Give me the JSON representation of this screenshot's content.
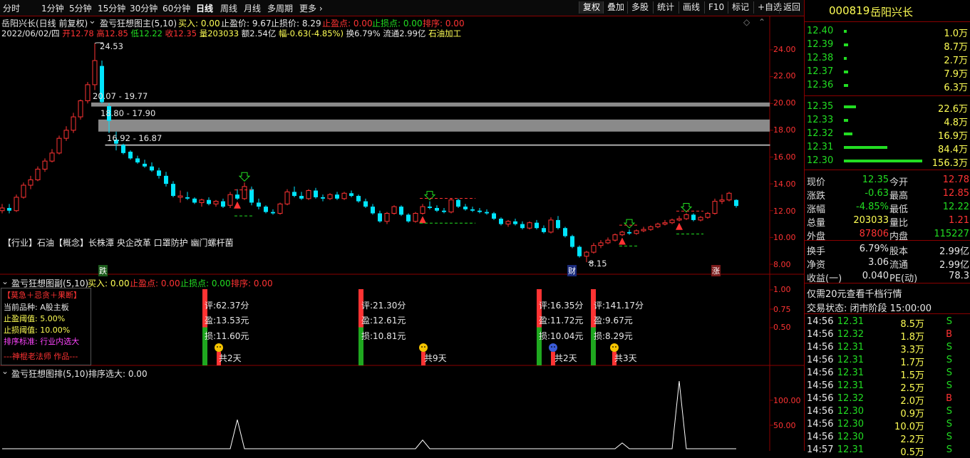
{
  "topbar": {
    "periods": [
      "分时",
      "1分钟",
      "5分钟",
      "15分钟",
      "30分钟",
      "60分钟",
      "日线",
      "周线",
      "月线",
      "多周期",
      "更多"
    ],
    "active_period": "日线",
    "right_buttons": [
      "复权",
      "叠加",
      "多股",
      "统计",
      "画线",
      "F10",
      "标记",
      "+自选",
      "返回"
    ],
    "active_right": "复权"
  },
  "chart_header": {
    "stock_title": "岳阳兴长(日线 前复权)",
    "indicator_main": "盈亏狂想图主(5,10)",
    "buy_label": "买入: 0.00",
    "profit_price_label": "止盈价: 9.67",
    "stop_price_label": "止损价: 8.29",
    "stop_profit_point": "止盈点: 0.00",
    "stop_loss_point": "止损点: 0.00",
    "rank": "排序: 0.00"
  },
  "quote_line": {
    "date": "2022/06/02/四",
    "open": "开12.78",
    "high": "高12.85",
    "low": "低12.22",
    "close": "收12.35",
    "volume": "量203033",
    "amount": "额2.54亿",
    "change": "幅-0.63(-4.85%)",
    "turnover": "换6.79%",
    "float_cap": "流通2.99亿",
    "industry": "石油加工"
  },
  "annotations": {
    "high_price": "24.53",
    "gap1": "20.07 - 19.77",
    "gap2": "18.80 - 17.90",
    "gap3": "16.92 - 16.87",
    "low_price": "8.15",
    "marker_die": "跌",
    "marker_cai": "财",
    "marker_zhang": "涨",
    "concept_text": "【行业】石油【概念】长株潭 央企改革 口罩防护 幽门螺杆菌"
  },
  "main_axis": [
    "24.00",
    "22.00",
    "20.00",
    "18.00",
    "16.00",
    "14.00",
    "12.00",
    "10.00",
    "8.00"
  ],
  "sub1": {
    "title": "盈亏狂想图副(5,10)",
    "buy": "买入: 0.00",
    "stop_profit": "止盈点: 0.00",
    "stop_loss": "止损点: 0.00",
    "rank": "排序: 0.00",
    "axis": [
      "1.00",
      "0.75",
      "0.50"
    ],
    "info_head": "【莫急＋忌贪＋果断】",
    "info_lines": [
      "当前品种:  A股主板",
      "止盈阈值:  5.00%",
      "止损阈值:  10.00%",
      "排序标准:  行业内选大",
      "---神棍老法师 作品---"
    ],
    "signals": [
      {
        "score": "评:62.37分",
        "profit": "盈:13.53元",
        "loss": "损:11.60元",
        "days": "共2天"
      },
      {
        "score": "评:21.30分",
        "profit": "盈:12.61元",
        "loss": "损:10.81元",
        "days": "共9天"
      },
      {
        "score": "评:16.35分",
        "profit": "盈:11.72元",
        "loss": "损:10.04元",
        "days": "共2天"
      },
      {
        "score": "评:141.17分",
        "profit": "盈:9.67元",
        "loss": "损:8.29元",
        "days": "共3天"
      }
    ]
  },
  "sub2": {
    "title": "盈亏狂想图排(5,10)",
    "rank": "排序选大: 0.00",
    "axis": [
      "100.00",
      "50.00"
    ]
  },
  "right_panel": {
    "code": "000819",
    "name": "岳阳兴长",
    "asks": [
      {
        "price": "12.40",
        "vol": "1.0万",
        "bar": 0.03
      },
      {
        "price": "12.39",
        "vol": "8.7万",
        "bar": 0.05
      },
      {
        "price": "12.38",
        "vol": "2.7万",
        "bar": 0.04
      },
      {
        "price": "12.37",
        "vol": "7.9万",
        "bar": 0.05
      },
      {
        "price": "12.36",
        "vol": "6.3万",
        "bar": 0.05
      }
    ],
    "bids": [
      {
        "price": "12.35",
        "vol": "22.6万",
        "bar": 0.15
      },
      {
        "price": "12.33",
        "vol": "4.8万",
        "bar": 0.05
      },
      {
        "price": "12.32",
        "vol": "16.9万",
        "bar": 0.11
      },
      {
        "price": "12.31",
        "vol": "84.4万",
        "bar": 0.55
      },
      {
        "price": "12.30",
        "vol": "156.3万",
        "bar": 1.0
      }
    ],
    "stats": [
      {
        "l1": "现价",
        "v1": "12.35",
        "c1": "g",
        "l2": "今开",
        "v2": "12.78",
        "c2": "r"
      },
      {
        "l1": "涨跌",
        "v1": "-0.63",
        "c1": "g",
        "l2": "最高",
        "v2": "12.85",
        "c2": "r"
      },
      {
        "l1": "涨幅",
        "v1": "-4.85%",
        "c1": "g",
        "l2": "最低",
        "v2": "12.22",
        "c2": "g"
      },
      {
        "l1": "总量",
        "v1": "203033",
        "c1": "y",
        "l2": "量比",
        "v2": "1.21",
        "c2": "r"
      },
      {
        "l1": "外盘",
        "v1": "87806",
        "c1": "r",
        "l2": "内盘",
        "v2": "115227",
        "c2": "g"
      }
    ],
    "stats2": [
      {
        "l1": "换手",
        "v1": "6.79%",
        "l2": "股本",
        "v2": "2.99亿"
      },
      {
        "l1": "净资",
        "v1": "3.06",
        "l2": "流通",
        "v2": "2.99亿"
      },
      {
        "l1": "收益(一)",
        "v1": "0.040",
        "l2": "PE(动)",
        "v2": "78.3"
      }
    ],
    "promo": "仅需20元查看千档行情",
    "trade_state": "交易状态: 闭市阶段 15:00:00",
    "ticks": [
      {
        "t": "14:56",
        "p": "12.31",
        "v": "8.5万",
        "s": "S"
      },
      {
        "t": "14:56",
        "p": "12.32",
        "v": "1.8万",
        "s": "B"
      },
      {
        "t": "14:56",
        "p": "12.31",
        "v": "3.3万",
        "s": "S"
      },
      {
        "t": "14:56",
        "p": "12.31",
        "v": "1.7万",
        "s": "S"
      },
      {
        "t": "14:56",
        "p": "12.31",
        "v": "1.5万",
        "s": "S"
      },
      {
        "t": "14:56",
        "p": "12.31",
        "v": "2.5万",
        "s": "S"
      },
      {
        "t": "14:56",
        "p": "12.32",
        "v": "2.0万",
        "s": "B"
      },
      {
        "t": "14:56",
        "p": "12.30",
        "v": "0.9万",
        "s": "S"
      },
      {
        "t": "14:56",
        "p": "12.30",
        "v": "10.0万",
        "s": "S"
      },
      {
        "t": "14:56",
        "p": "12.30",
        "v": "2.2万",
        "s": "S"
      },
      {
        "t": "14:57",
        "p": "12.31",
        "v": "0.5万",
        "s": "S"
      }
    ]
  },
  "chart_data": {
    "type": "candlestick",
    "title": "岳阳兴长(日线 前复权)",
    "ylim": [
      7.4,
      25.8
    ],
    "candles": [
      [
        12.0,
        12.5,
        11.8,
        12.2
      ],
      [
        12.2,
        12.5,
        11.8,
        12.0
      ],
      [
        12.0,
        13.2,
        11.9,
        13.0
      ],
      [
        13.0,
        14.1,
        12.9,
        13.9
      ],
      [
        13.9,
        14.6,
        13.6,
        14.3
      ],
      [
        14.3,
        15.3,
        14.2,
        15.1
      ],
      [
        15.1,
        15.9,
        14.9,
        15.7
      ],
      [
        15.7,
        16.6,
        15.6,
        16.3
      ],
      [
        16.3,
        17.6,
        16.2,
        17.4
      ],
      [
        17.4,
        18.3,
        17.2,
        18.0
      ],
      [
        18.0,
        19.3,
        17.8,
        19.0
      ],
      [
        19.0,
        20.3,
        18.8,
        20.2
      ],
      [
        20.2,
        21.6,
        20.0,
        21.4
      ],
      [
        21.4,
        24.5,
        21.0,
        23.2
      ],
      [
        22.8,
        23.2,
        20.0,
        20.1
      ],
      [
        19.8,
        20.0,
        17.8,
        18.7
      ],
      [
        17.3,
        17.9,
        16.5,
        17.0
      ],
      [
        16.9,
        17.0,
        16.2,
        16.3
      ],
      [
        16.4,
        16.5,
        15.8,
        15.9
      ],
      [
        15.9,
        16.1,
        15.5,
        15.6
      ],
      [
        15.5,
        15.8,
        15.2,
        15.3
      ],
      [
        15.3,
        15.6,
        14.9,
        15.0
      ],
      [
        15.0,
        15.2,
        14.4,
        14.6
      ],
      [
        14.6,
        14.9,
        13.8,
        14.0
      ],
      [
        14.0,
        14.2,
        13.0,
        13.1
      ],
      [
        13.0,
        13.5,
        12.6,
        13.1
      ],
      [
        13.0,
        13.4,
        12.8,
        12.9
      ],
      [
        12.9,
        13.0,
        12.5,
        12.6
      ],
      [
        12.6,
        12.9,
        12.3,
        12.8
      ],
      [
        12.8,
        13.0,
        12.4,
        12.5
      ],
      [
        12.5,
        12.8,
        12.3,
        12.7
      ],
      [
        12.7,
        12.9,
        12.2,
        12.3
      ],
      [
        12.4,
        13.4,
        12.2,
        13.2
      ],
      [
        13.2,
        13.6,
        12.8,
        12.9
      ],
      [
        12.9,
        14.1,
        12.8,
        13.8
      ],
      [
        13.6,
        13.8,
        12.4,
        12.6
      ],
      [
        12.6,
        12.9,
        12.1,
        12.3
      ],
      [
        12.3,
        12.4,
        11.8,
        11.9
      ],
      [
        11.9,
        12.1,
        11.7,
        11.8
      ],
      [
        11.8,
        12.6,
        11.7,
        12.5
      ],
      [
        12.5,
        13.6,
        12.4,
        13.4
      ],
      [
        13.4,
        13.8,
        13.0,
        13.1
      ],
      [
        13.1,
        13.4,
        12.8,
        12.9
      ],
      [
        12.9,
        13.6,
        12.8,
        13.5
      ],
      [
        13.5,
        13.7,
        12.9,
        13.0
      ],
      [
        13.0,
        13.2,
        12.7,
        12.9
      ],
      [
        12.9,
        13.3,
        12.8,
        13.2
      ],
      [
        13.2,
        13.4,
        12.8,
        12.9
      ],
      [
        12.9,
        13.4,
        12.8,
        13.3
      ],
      [
        13.3,
        13.5,
        13.0,
        13.1
      ],
      [
        13.1,
        13.2,
        12.6,
        12.7
      ],
      [
        12.7,
        12.9,
        12.2,
        12.3
      ],
      [
        12.3,
        12.5,
        11.7,
        11.8
      ],
      [
        11.8,
        12.0,
        11.1,
        11.2
      ],
      [
        11.2,
        11.9,
        11.0,
        11.8
      ],
      [
        11.8,
        12.4,
        11.7,
        12.3
      ],
      [
        12.3,
        12.4,
        11.6,
        11.7
      ],
      [
        11.7,
        11.8,
        11.1,
        11.2
      ],
      [
        11.2,
        11.9,
        11.1,
        11.8
      ],
      [
        11.8,
        12.5,
        11.7,
        12.3
      ],
      [
        12.3,
        12.7,
        12.1,
        12.2
      ],
      [
        12.2,
        12.4,
        11.9,
        12.0
      ],
      [
        12.0,
        12.2,
        11.8,
        11.9
      ],
      [
        11.9,
        12.9,
        11.8,
        12.8
      ],
      [
        12.8,
        12.9,
        12.2,
        12.3
      ],
      [
        12.3,
        12.5,
        12.0,
        12.1
      ],
      [
        12.1,
        12.3,
        11.9,
        12.0
      ],
      [
        12.0,
        12.2,
        11.8,
        11.9
      ],
      [
        11.9,
        12.1,
        11.7,
        11.8
      ],
      [
        11.8,
        11.9,
        11.3,
        11.4
      ],
      [
        11.4,
        11.5,
        10.9,
        11.0
      ],
      [
        11.0,
        11.3,
        10.8,
        11.2
      ],
      [
        11.2,
        11.4,
        10.9,
        11.0
      ],
      [
        11.0,
        11.2,
        10.6,
        10.7
      ],
      [
        10.7,
        11.2,
        10.6,
        11.1
      ],
      [
        11.1,
        11.3,
        10.6,
        10.7
      ],
      [
        10.7,
        10.9,
        10.3,
        10.4
      ],
      [
        10.4,
        11.5,
        10.3,
        11.3
      ],
      [
        11.3,
        11.6,
        10.6,
        10.7
      ],
      [
        10.7,
        10.8,
        10.0,
        10.1
      ],
      [
        10.1,
        10.2,
        9.2,
        9.3
      ],
      [
        9.3,
        9.4,
        8.5,
        8.6
      ],
      [
        8.6,
        9.0,
        8.15,
        8.9
      ],
      [
        8.9,
        9.6,
        8.8,
        9.4
      ],
      [
        9.4,
        9.8,
        9.2,
        9.6
      ],
      [
        9.6,
        10.0,
        9.5,
        9.8
      ],
      [
        9.8,
        10.3,
        9.7,
        10.2
      ],
      [
        10.2,
        10.5,
        10.1,
        10.4
      ],
      [
        10.4,
        10.6,
        10.2,
        10.3
      ],
      [
        10.3,
        10.6,
        10.2,
        10.5
      ],
      [
        10.5,
        10.8,
        10.4,
        10.6
      ],
      [
        10.6,
        10.9,
        10.5,
        10.8
      ],
      [
        10.8,
        11.1,
        10.7,
        11.0
      ],
      [
        11.0,
        11.3,
        10.9,
        11.1
      ],
      [
        11.1,
        11.4,
        11.0,
        11.3
      ],
      [
        11.3,
        11.6,
        11.2,
        11.4
      ],
      [
        11.4,
        11.8,
        11.3,
        11.7
      ],
      [
        11.7,
        11.8,
        11.2,
        11.3
      ],
      [
        11.3,
        11.6,
        11.2,
        11.5
      ],
      [
        11.5,
        11.9,
        11.4,
        11.8
      ],
      [
        11.8,
        12.9,
        11.7,
        12.7
      ],
      [
        12.7,
        13.2,
        12.5,
        12.8
      ],
      [
        12.8,
        13.4,
        12.7,
        13.3
      ],
      [
        12.8,
        12.85,
        12.22,
        12.35
      ]
    ],
    "gaps": [
      [
        19.77,
        20.07
      ],
      [
        17.9,
        18.8
      ],
      [
        16.87,
        16.92
      ]
    ],
    "signal_days": [
      33,
      59,
      87,
      95
    ],
    "rank_spikes": [
      {
        "day": 33,
        "value": 60
      },
      {
        "day": 59,
        "value": 18
      },
      {
        "day": 87,
        "value": 12
      },
      {
        "day": 95,
        "value": 140
      }
    ]
  },
  "colors": {
    "up": "#ff3333",
    "down": "#00e5ff",
    "bg": "#000000",
    "border": "#8b0000",
    "buy": "#ff3333",
    "sell": "#22dd22"
  }
}
